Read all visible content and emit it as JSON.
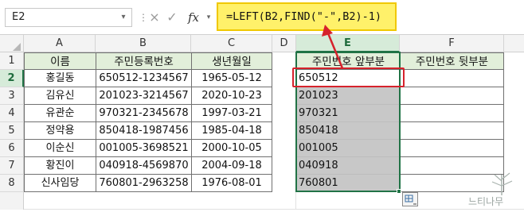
{
  "formula_bar": {
    "name_box": "E2",
    "cancel_icon": "×",
    "enter_icon": "✓",
    "fx_label": "fx",
    "formula": "=LEFT(B2,FIND(\"-\",B2)-1)"
  },
  "columns": [
    "A",
    "B",
    "C",
    "D",
    "E",
    "F"
  ],
  "rows": [
    "1",
    "2",
    "3",
    "4",
    "5",
    "6",
    "7",
    "8"
  ],
  "table": {
    "headers": {
      "name": "이름",
      "ssn": "주민등록번호",
      "birth": "생년월일"
    },
    "records": [
      {
        "name": "홍길동",
        "ssn": "650512-1234567",
        "birth": "1965-05-12"
      },
      {
        "name": "김유신",
        "ssn": "201023-3214567",
        "birth": "2020-10-23"
      },
      {
        "name": "유관순",
        "ssn": "970321-2345678",
        "birth": "1997-03-21"
      },
      {
        "name": "정약용",
        "ssn": "850418-1987456",
        "birth": "1985-04-18"
      },
      {
        "name": "이순신",
        "ssn": "001005-3698521",
        "birth": "2000-10-05"
      },
      {
        "name": "황진이",
        "ssn": "040918-4569870",
        "birth": "2004-09-18"
      },
      {
        "name": "신사임당",
        "ssn": "760801-2963258",
        "birth": "1976-08-01"
      }
    ]
  },
  "split_table": {
    "headers": {
      "front": "주민번호 앞부분",
      "back": "주민번호 뒷부분"
    },
    "front_values": [
      "650512",
      "201023",
      "970321",
      "850418",
      "001005",
      "040918",
      "760801"
    ]
  },
  "watermark": "느티나무",
  "colors": {
    "highlight": "#fff16a",
    "selection": "#217346",
    "annotation": "#d6222c",
    "header_fill": "#e2efda"
  }
}
